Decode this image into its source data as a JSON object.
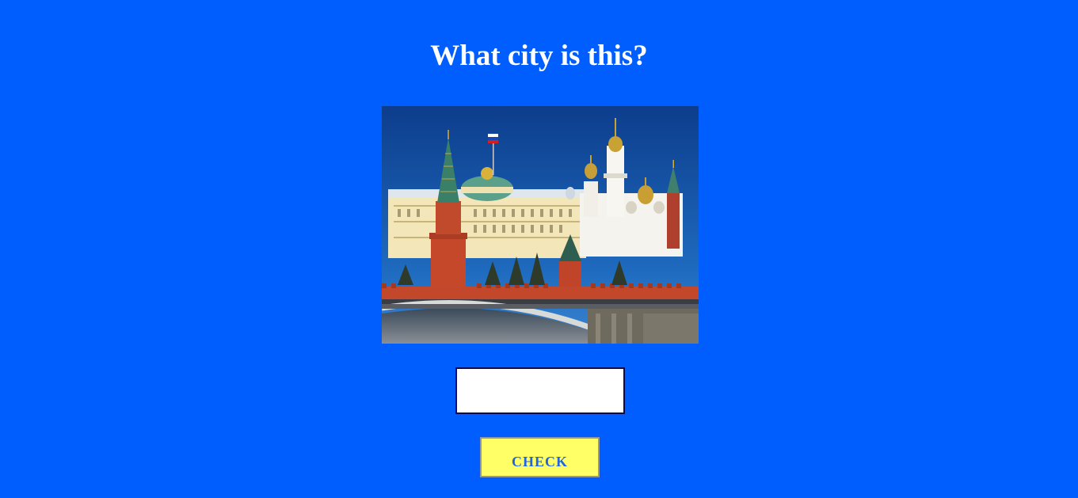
{
  "quiz": {
    "question": "What city is this?",
    "image_subject": "kremlin-moscow-photo",
    "answer_value": "",
    "answer_placeholder": "",
    "check_label": "CHECK"
  },
  "colors": {
    "background": "#005eff",
    "title_text": "#ffffff",
    "button_bg": "#ffff66",
    "button_text": "#1f63e8"
  }
}
